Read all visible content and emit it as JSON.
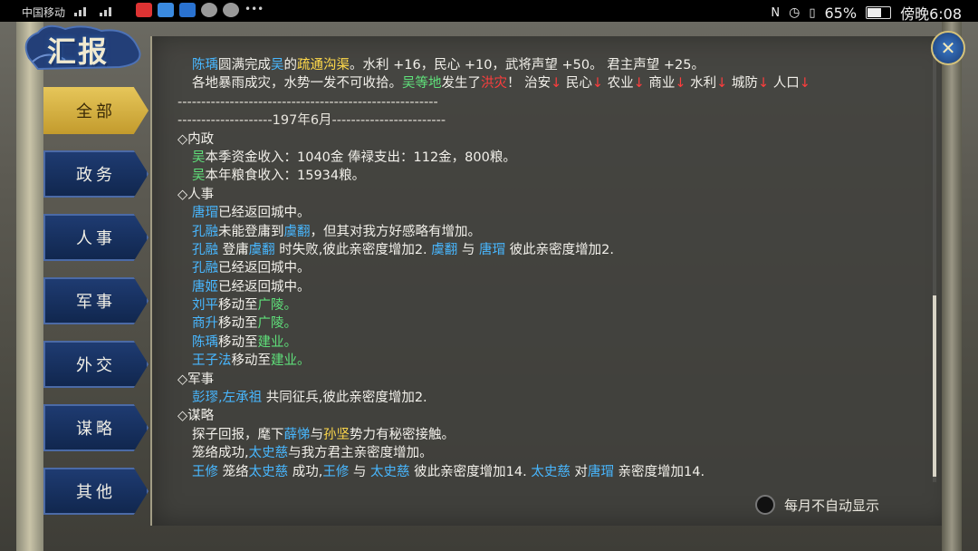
{
  "statusbar": {
    "carrier": "中国移动",
    "battery": "65%",
    "time": "傍晚6:08"
  },
  "title": "汇报",
  "close_icon_glyph": "✕",
  "tabs": [
    {
      "label": "全部",
      "active": true
    },
    {
      "label": "政务",
      "active": false
    },
    {
      "label": "人事",
      "active": false
    },
    {
      "label": "军事",
      "active": false
    },
    {
      "label": "外交",
      "active": false
    },
    {
      "label": "谋略",
      "active": false
    },
    {
      "label": "其他",
      "active": false
    }
  ],
  "colors": {
    "name": "#48b7ff",
    "place": "#5fe07a",
    "highlight": "#ffd94a",
    "alert": "#ff3d3d"
  },
  "report_lines": [
    {
      "indent": true,
      "segs": [
        [
          "陈瑀",
          "name"
        ],
        [
          "圆满完成",
          ""
        ],
        [
          "吴",
          "name"
        ],
        [
          "的",
          ""
        ],
        [
          "疏通沟渠",
          "yellow"
        ],
        [
          "。水利 +16，民心 +10，武将声望 +50。 君主声望 +25。",
          ""
        ]
      ]
    },
    {
      "indent": true,
      "segs": [
        [
          "各地暴雨成灾，水势一发不可收拾。",
          ""
        ],
        [
          "吴等地",
          "place"
        ],
        [
          "发生了",
          ""
        ],
        [
          "洪灾",
          "red"
        ],
        [
          "！ 治安",
          ""
        ],
        [
          "↓",
          "red"
        ],
        [
          " 民心",
          ""
        ],
        [
          "↓",
          "red"
        ],
        [
          " 农业",
          ""
        ],
        [
          "↓",
          "red"
        ],
        [
          " 商业",
          ""
        ],
        [
          "↓",
          "red"
        ],
        [
          " 水利",
          ""
        ],
        [
          "↓",
          "red"
        ],
        [
          " 城防",
          ""
        ],
        [
          "↓",
          "red"
        ],
        [
          " 人口",
          ""
        ],
        [
          "↓",
          "red"
        ]
      ]
    },
    {
      "indent": false,
      "segs": [
        [
          "-------------------------------------------------------",
          "sep"
        ]
      ]
    },
    {
      "indent": false,
      "segs": [
        [
          "--------------------197年6月------------------------",
          "sep"
        ]
      ]
    },
    {
      "indent": false,
      "segs": [
        [
          "◇内政",
          ""
        ]
      ]
    },
    {
      "indent": true,
      "segs": [
        [
          "吴",
          "place"
        ],
        [
          "本季资金收入：1040金 俸禄支出：112金，800粮。",
          ""
        ]
      ]
    },
    {
      "indent": true,
      "segs": [
        [
          "吴",
          "place"
        ],
        [
          "本年粮食收入：15934粮。",
          ""
        ]
      ]
    },
    {
      "indent": false,
      "segs": [
        [
          "◇人事",
          ""
        ]
      ]
    },
    {
      "indent": true,
      "segs": [
        [
          "唐瑁",
          "name"
        ],
        [
          "已经返回城中。",
          ""
        ]
      ]
    },
    {
      "indent": true,
      "segs": [
        [
          "孔融",
          "name"
        ],
        [
          "未能登庸到",
          ""
        ],
        [
          "虞翻",
          "name"
        ],
        [
          "，但其对我方好感略有增加。",
          ""
        ]
      ]
    },
    {
      "indent": true,
      "segs": [
        [
          "孔融",
          "name"
        ],
        [
          " 登庸",
          ""
        ],
        [
          "虞翻",
          "name"
        ],
        [
          " 时失败,彼此亲密度增加2. ",
          ""
        ],
        [
          "虞翻",
          "name"
        ],
        [
          " 与 ",
          ""
        ],
        [
          "唐瑁",
          "name"
        ],
        [
          " 彼此亲密度增加2.",
          ""
        ]
      ]
    },
    {
      "indent": true,
      "segs": [
        [
          "孔融",
          "name"
        ],
        [
          "已经返回城中。",
          ""
        ]
      ]
    },
    {
      "indent": true,
      "segs": [
        [
          "唐姬",
          "name"
        ],
        [
          "已经返回城中。",
          ""
        ]
      ]
    },
    {
      "indent": true,
      "segs": [
        [
          "刘平",
          "name"
        ],
        [
          "移动至",
          ""
        ],
        [
          "广陵。",
          "place"
        ]
      ]
    },
    {
      "indent": true,
      "segs": [
        [
          "商升",
          "name"
        ],
        [
          "移动至",
          ""
        ],
        [
          "广陵。",
          "place"
        ]
      ]
    },
    {
      "indent": true,
      "segs": [
        [
          "陈瑀",
          "name"
        ],
        [
          "移动至",
          ""
        ],
        [
          "建业。",
          "place"
        ]
      ]
    },
    {
      "indent": true,
      "segs": [
        [
          "王子法",
          "name"
        ],
        [
          "移动至",
          ""
        ],
        [
          "建业。",
          "place"
        ]
      ]
    },
    {
      "indent": false,
      "segs": [
        [
          "◇军事",
          ""
        ]
      ]
    },
    {
      "indent": true,
      "segs": [
        [
          "彭璆,左承祖",
          "name"
        ],
        [
          " 共同征兵,彼此亲密度增加2.",
          ""
        ]
      ]
    },
    {
      "indent": false,
      "segs": [
        [
          "◇谋略",
          ""
        ]
      ]
    },
    {
      "indent": true,
      "segs": [
        [
          "探子回报，麾下",
          ""
        ],
        [
          "薛悌",
          "name"
        ],
        [
          "与",
          ""
        ],
        [
          "孙坚",
          "yellow"
        ],
        [
          "势力有秘密接触。",
          ""
        ]
      ]
    },
    {
      "indent": true,
      "segs": [
        [
          "笼络成功,",
          ""
        ],
        [
          "太史慈",
          "name"
        ],
        [
          "与我方君主亲密度增加。",
          ""
        ]
      ]
    },
    {
      "indent": true,
      "segs": [
        [
          "王修",
          "name"
        ],
        [
          " 笼络",
          ""
        ],
        [
          "太史慈",
          "name"
        ],
        [
          " 成功,",
          ""
        ],
        [
          "王修",
          "name"
        ],
        [
          " 与 ",
          ""
        ],
        [
          "太史慈",
          "name"
        ],
        [
          " 彼此亲密度增加14. ",
          ""
        ],
        [
          "太史慈",
          "name"
        ],
        [
          " 对",
          ""
        ],
        [
          "唐瑁",
          "name"
        ],
        [
          " 亲密度增加14.",
          ""
        ]
      ]
    }
  ],
  "auto_display_label": "每月不自动显示"
}
